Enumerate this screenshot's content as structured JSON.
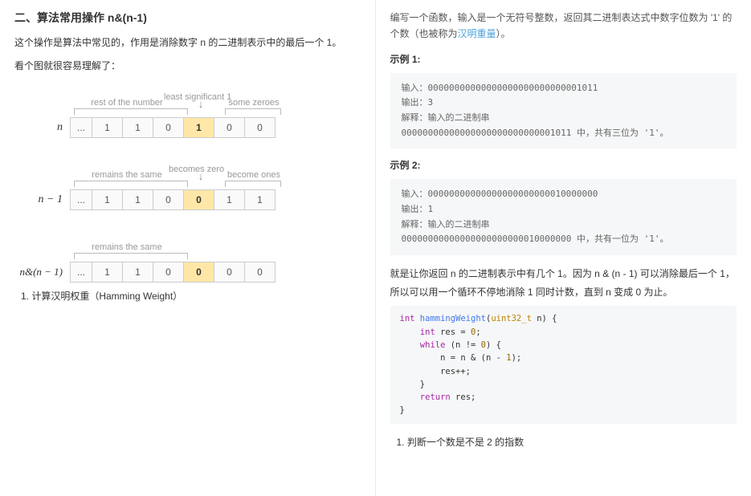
{
  "left": {
    "heading": "二、算法常用操作 n&(n-1)",
    "intro1": "这个操作是算法中常见的，作用是消除数字 n 的二进制表示中的最后一个 1。",
    "intro2": "看个图就很容易理解了：",
    "diag1": {
      "label_left": "rest of the number",
      "label_mid": "least significant 1",
      "label_right": "some zeroes",
      "rowlbl": "n",
      "cells": [
        "...",
        "1",
        "1",
        "0",
        "1",
        "0",
        "0"
      ]
    },
    "diag2": {
      "label_left": "remains the same",
      "label_mid": "becomes zero",
      "label_right": "become ones",
      "rowlbl": "n − 1",
      "cells": [
        "...",
        "1",
        "1",
        "0",
        "0",
        "1",
        "1"
      ]
    },
    "diag3": {
      "label_left": "remains the same",
      "rowlbl": "n&(n − 1)",
      "cells": [
        "...",
        "1",
        "1",
        "0",
        "0",
        "0",
        "0"
      ]
    },
    "list1": "1. 计算汉明权重（Hamming Weight）"
  },
  "right": {
    "problem": "编写一个函数，输入是一个无符号整数，返回其二进制表达式中数字位数为 '1' 的个数（也被称为",
    "link": "汉明重量",
    "problem_tail": "）。",
    "ex1_title": "示例 1:",
    "ex1_in_lbl": "输入：",
    "ex1_in": "00000000000000000000000000001011",
    "ex1_out_lbl": "输出：",
    "ex1_out": "3",
    "ex1_exp_lbl": "解释：",
    "ex1_exp": "输入的二进制串",
    "ex1_exp2": "00000000000000000000000000001011 中，共有三位为 '1'。",
    "ex2_title": "示例 2:",
    "ex2_in": "00000000000000000000000010000000",
    "ex2_out": "1",
    "ex2_exp": "输入的二进制串",
    "ex2_exp2": "00000000000000000000000010000000 中，共有一位为 '1'。",
    "explain": "就是让你返回 n 的二进制表示中有几个 1。因为 n & (n - 1) 可以消除最后一个 1，所以可以用一个循环不停地消除 1 同时计数，直到 n 变成 0 为止。",
    "code_fn": "hammingWeight",
    "code_ty": "uint32_t",
    "list2": "1. 判断一个数是不是 2 的指数"
  }
}
